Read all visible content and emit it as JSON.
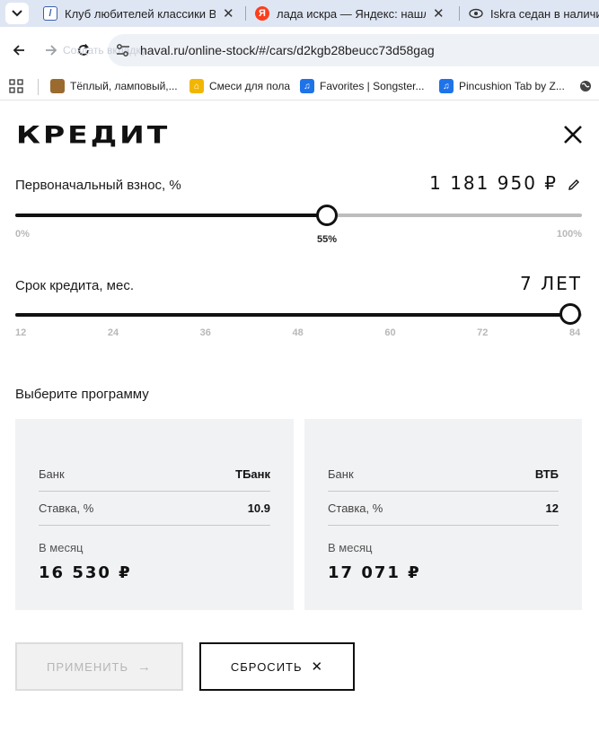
{
  "browser": {
    "tabs": [
      {
        "title": "Клуб любителей классики ВАЗ",
        "favicon": "forum-icon"
      },
      {
        "title": "лада искра — Яндекс: нашлось",
        "favicon": "yandex-icon"
      },
      {
        "title": "Iskra седан в наличии",
        "favicon": "eye-icon"
      }
    ],
    "url": "haval.ru/online-stock/#/cars/d2kgb28beucc73d58gag",
    "omnibox_ghost": "Создать вкладку",
    "bookmarks": [
      {
        "label": "Тёплый, ламповый,...",
        "icon": "wood-icon"
      },
      {
        "label": "Смеси для пола",
        "icon": "house-icon"
      },
      {
        "label": "Favorites | Songster...",
        "icon": "songsterr-icon"
      },
      {
        "label": "Pincushion Tab by Z...",
        "icon": "songsterr-icon"
      }
    ]
  },
  "page": {
    "title": "КРЕДИТ",
    "down_payment": {
      "label": "Первоначальный взнос, %",
      "value": "1 181 950 ₽",
      "percent_label": "55%",
      "percent": 55,
      "min_label": "0%",
      "max_label": "100%"
    },
    "term": {
      "label": "Срок кредита, мес.",
      "value": "7 ЛЕТ",
      "ticks": [
        "12",
        "24",
        "36",
        "48",
        "60",
        "72",
        "84"
      ],
      "selected_months": 84
    },
    "program_title": "Выберите программу",
    "programs": [
      {
        "bank_label": "Банк",
        "bank": "ТБанк",
        "rate_label": "Ставка, %",
        "rate": "10.9",
        "monthly_label": "В месяц",
        "monthly": "16 530 ₽"
      },
      {
        "bank_label": "Банк",
        "bank": "ВТБ",
        "rate_label": "Ставка, %",
        "rate": "12",
        "monthly_label": "В месяц",
        "monthly": "17 071 ₽"
      }
    ],
    "apply_label": "ПРИМЕНИТЬ",
    "reset_label": "СБРОСИТЬ"
  },
  "colors": {
    "accent": "#111111",
    "card_bg": "#f1f2f4",
    "track_inactive": "#bdbdbd",
    "disabled_text": "#b6b6b6"
  }
}
